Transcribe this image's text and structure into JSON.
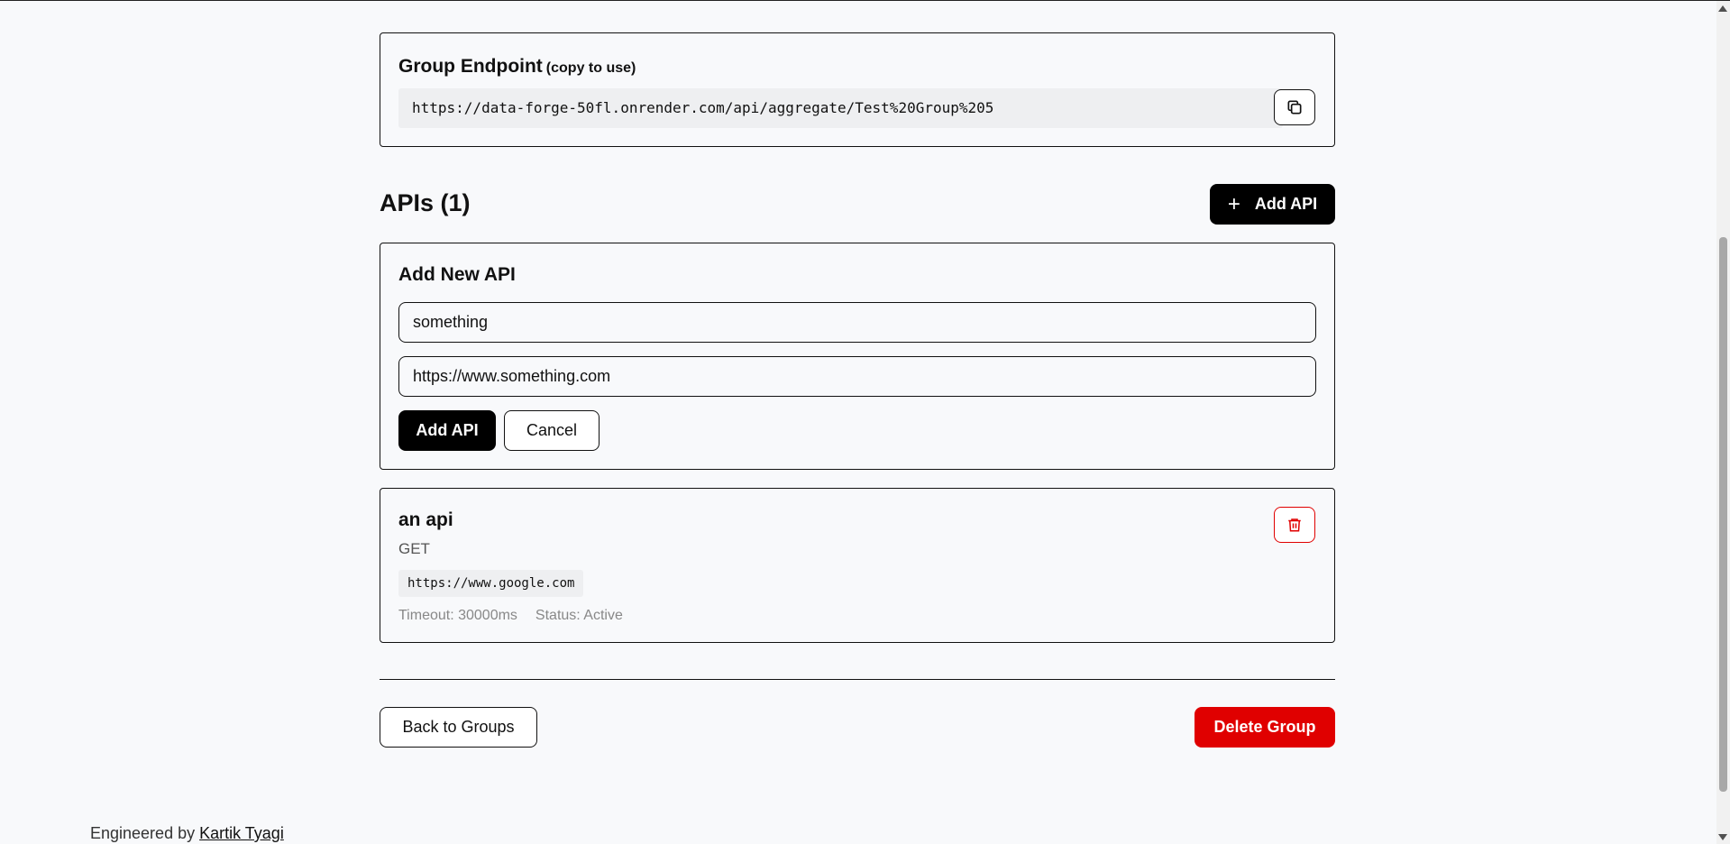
{
  "endpoint": {
    "title": "Group Endpoint",
    "hint": "(copy to use)",
    "url": "https://data-forge-50fl.onrender.com/api/aggregate/Test%20Group%205",
    "copy_icon": "copy-icon"
  },
  "apis_section": {
    "title": "APIs (1)",
    "add_button_label": "Add API",
    "add_button_icon": "plus-icon"
  },
  "add_form": {
    "title": "Add New API",
    "name_value": "something",
    "url_value": "https://www.something.com",
    "submit_label": "Add API",
    "cancel_label": "Cancel"
  },
  "api_items": [
    {
      "name": "an api",
      "method": "GET",
      "url": "https://www.google.com",
      "timeout": "Timeout: 30000ms",
      "status": "Status: Active",
      "delete_icon": "trash-icon"
    }
  ],
  "actions": {
    "back_label": "Back to Groups",
    "delete_group_label": "Delete Group"
  },
  "footer": {
    "prefix": "Engineered by",
    "author": "Kartik Tyagi"
  },
  "colors": {
    "background": "#f8f9fb",
    "primary": "#000000",
    "danger": "#e00000",
    "code_bg": "#eeeff1"
  }
}
